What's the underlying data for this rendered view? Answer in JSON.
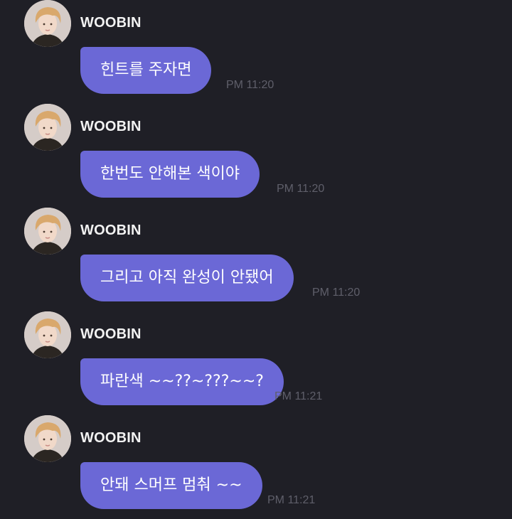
{
  "messages": [
    {
      "sender": "WOOBIN",
      "text": "힌트를 주자면",
      "time": "PM 11:20"
    },
    {
      "sender": "WOOBIN",
      "text": "한번도 안해본 색이야",
      "time": "PM 11:20"
    },
    {
      "sender": "WOOBIN",
      "text": "그리고 아직 완성이 안됐어",
      "time": "PM 11:20"
    },
    {
      "sender": "WOOBIN",
      "text": "파란색 ~~??~???~~?",
      "time": "PM 11:21"
    },
    {
      "sender": "WOOBIN",
      "text": "안돼 스머프 멈춰 ~~",
      "time": "PM 11:21"
    }
  ],
  "colors": {
    "background": "#1f1f26",
    "bubble": "#6b68d6",
    "bubble_text": "#ffffff",
    "sender_text": "#f2f2f2",
    "time_text": "#5f5f6a"
  },
  "icons": {
    "avatar": "profile-photo"
  }
}
